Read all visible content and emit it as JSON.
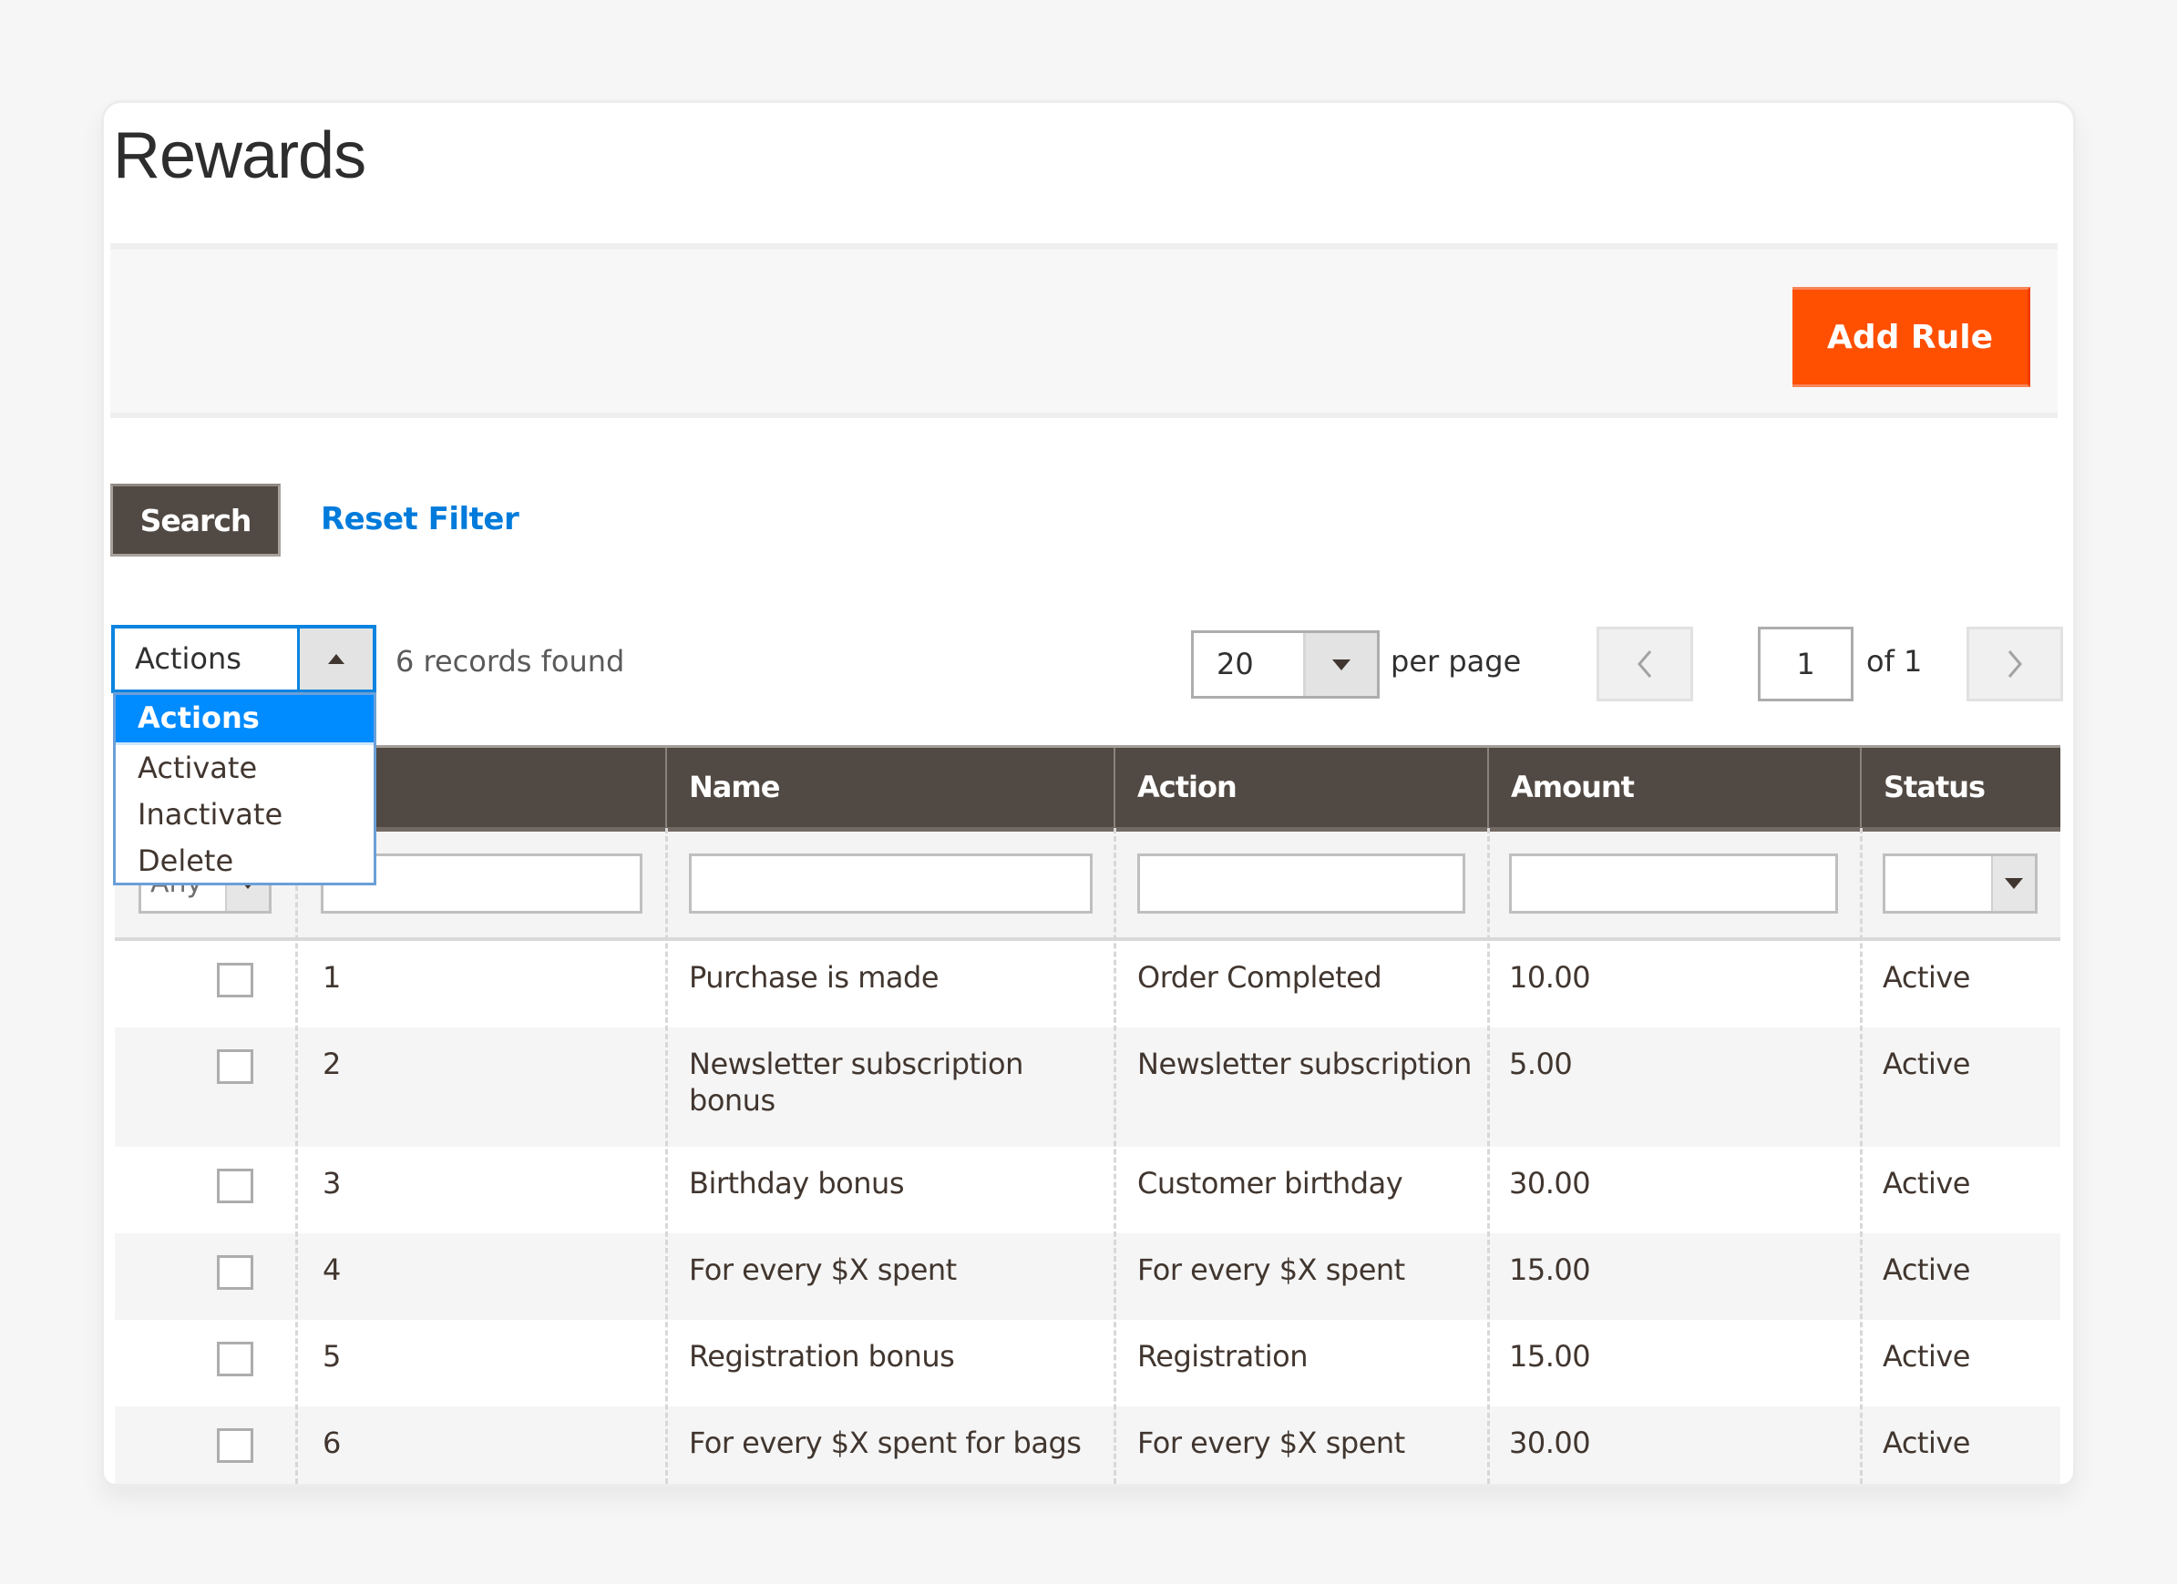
{
  "page": {
    "title": "Rewards"
  },
  "action_bar": {
    "add_rule_label": "Add Rule",
    "accent_color": "#ff4f00"
  },
  "filters_toolbar": {
    "search_label": "Search",
    "reset_label": "Reset Filter"
  },
  "mass_actions": {
    "selected": "Actions",
    "options": [
      "Actions",
      "Activate",
      "Inactivate",
      "Delete"
    ]
  },
  "records_found": "6 records found",
  "pagination": {
    "per_page": "20",
    "per_page_label": "per page",
    "prev_icon": "chevron-left-icon",
    "next_icon": "chevron-right-icon",
    "current_page": "1",
    "of_label": "of 1"
  },
  "grid": {
    "columns": [
      "",
      "",
      "Name",
      "Action",
      "Amount",
      "Status"
    ],
    "filters": {
      "checkbox_select": "Any",
      "id": "",
      "name": "",
      "action": "",
      "amount": "",
      "status": ""
    },
    "rows": [
      {
        "id": "1",
        "name": "Purchase is made",
        "action": "Order Completed",
        "amount": "10.00",
        "status": "Active"
      },
      {
        "id": "2",
        "name": "Newsletter subscription bonus",
        "action": "Newsletter subscription",
        "amount": "5.00",
        "status": "Active"
      },
      {
        "id": "3",
        "name": "Birthday bonus",
        "action": "Customer birthday",
        "amount": "30.00",
        "status": "Active"
      },
      {
        "id": "4",
        "name": "For every $X spent",
        "action": "For every $X spent",
        "amount": "15.00",
        "status": "Active"
      },
      {
        "id": "5",
        "name": "Registration bonus",
        "action": "Registration",
        "amount": "15.00",
        "status": "Active"
      },
      {
        "id": "6",
        "name": "For every $X spent for bags",
        "action": "For every $X spent",
        "amount": "30.00",
        "status": "Active"
      }
    ]
  }
}
